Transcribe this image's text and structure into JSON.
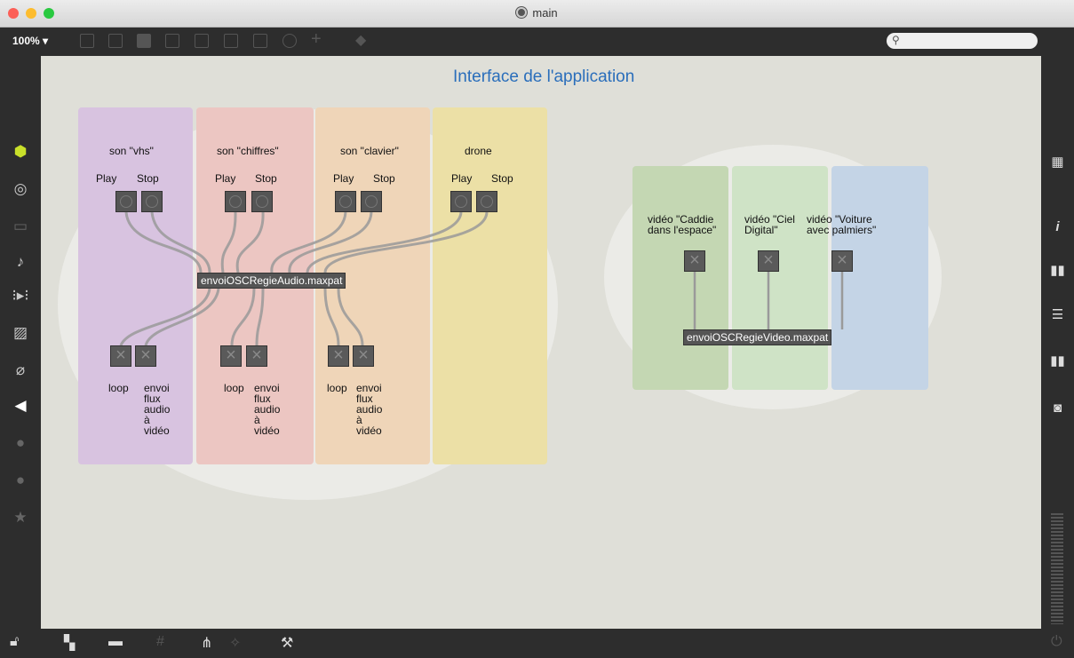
{
  "window": {
    "title": "main"
  },
  "toolbar": {
    "zoom": "100%",
    "zoom_arrow": "▾",
    "search_placeholder": ""
  },
  "canvas": {
    "title": "Interface de l'application",
    "audio": {
      "columns": [
        {
          "name": "son \"vhs\"",
          "play": "Play",
          "stop": "Stop",
          "loop": "loop",
          "send": "envoi\nflux\naudio\nà\nvidéo",
          "color": "#d8c3e0"
        },
        {
          "name": "son \"chiffres\"",
          "play": "Play",
          "stop": "Stop",
          "loop": "loop",
          "send": "envoi\nflux\naudio\nà\nvidéo",
          "color": "#ecc6c2"
        },
        {
          "name": "son \"clavier\"",
          "play": "Play",
          "stop": "Stop",
          "loop": "loop",
          "send": "envoi\nflux\naudio\nà\nvidéo",
          "color": "#efd5b8"
        },
        {
          "name": "drone",
          "play": "Play",
          "stop": "Stop",
          "color": "#ece0a6"
        }
      ],
      "object": "envoiOSCRegieAudio.maxpat"
    },
    "video": {
      "columns": [
        {
          "name": "vidéo \"Caddie\ndans l'espace\"",
          "color": "#c4d7b3"
        },
        {
          "name": "vidéo \"Ciel\nDigital\"",
          "color": "#cfe3c6"
        },
        {
          "name": "vidéo \"Voiture\navec palmiers\"",
          "color": "#c4d4e6"
        }
      ],
      "object": "envoiOSCRegieVideo.maxpat"
    }
  },
  "colors": {
    "canvas": "#dfdfd8",
    "title": "#2a6ebb",
    "toolbar": "#2d2d2d",
    "object": "#555555"
  },
  "icons": {
    "left": [
      "package-icon",
      "target-icon",
      "panel-icon",
      "music-note-icon",
      "playlist-icon",
      "image-icon",
      "paperclip-icon",
      "plug-icon",
      "p-icon",
      "b-icon",
      "star-icon"
    ],
    "right": [
      "grid-icon",
      "info-icon",
      "book-icon",
      "list-icon",
      "reference-icon",
      "snapshot-icon",
      "level-meter-icon"
    ],
    "bottom": [
      "lock-icon",
      "windows-icon",
      "presentation-icon",
      "grid-snap-icon",
      "hierarchy-icon",
      "debug-icon",
      "wrench-icon",
      "power-icon"
    ]
  }
}
